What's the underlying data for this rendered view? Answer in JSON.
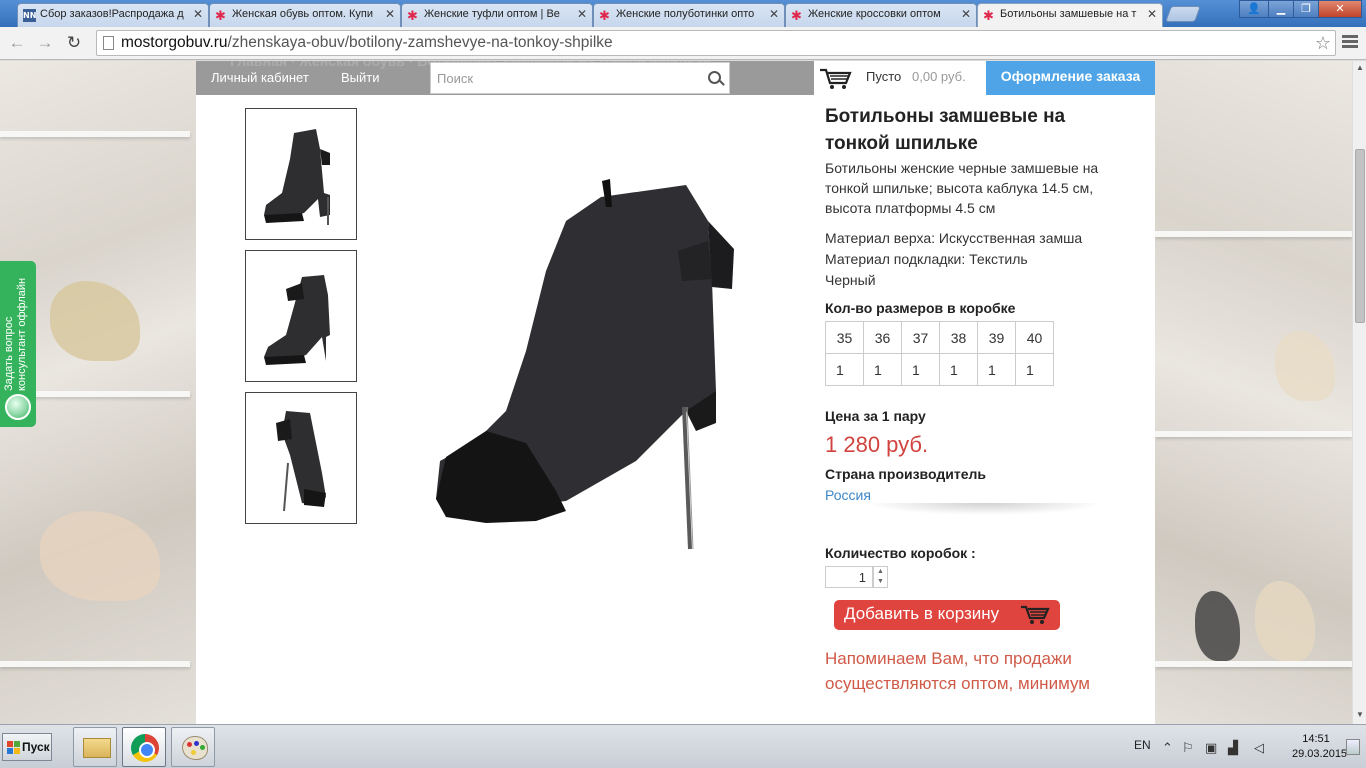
{
  "browser": {
    "tabs": [
      {
        "label": "Сбор заказов!Распродажа д",
        "icon": "nn-favicon",
        "active": false
      },
      {
        "label": "Женская обувь оптом. Купи",
        "icon": "star-favicon",
        "active": false
      },
      {
        "label": "Женские туфли оптом | Ве",
        "icon": "star-favicon",
        "active": false
      },
      {
        "label": "Женские полуботинки опто",
        "icon": "star-favicon",
        "active": false
      },
      {
        "label": "Женские кроссовки оптом",
        "icon": "star-favicon",
        "active": false
      },
      {
        "label": "Ботильоны замшевые на т",
        "icon": "star-favicon",
        "active": true
      }
    ],
    "address": {
      "host": "mostorgobuv.ru",
      "path": "/zhenskaya-obuv/botilony-zamshevye-na-tonkoy-shpilke"
    }
  },
  "header": {
    "breadcrumb_behind": "Главная · Женская обувь · Ботильоны замшевые на тонкой шпильке",
    "account_link": "Личный кабинет",
    "logout_link": "Выйти",
    "search_placeholder": "Поиск",
    "cart_status": "Пусто",
    "cart_sum": "0,00 руб.",
    "checkout_label": "Оформление заказа"
  },
  "product": {
    "title": "Ботильоны замшевые на тонкой шпильке",
    "description": "Ботильоны женские черные замшевые на тонкой шпильке; высота каблука 14.5 см, высота платформы 4.5 см",
    "material_upper": "Материал верха: Искусственная замша",
    "material_lining": "Материал подкладки: Текстиль",
    "color": "Черный",
    "sizes_label": "Кол-во размеров в коробке",
    "sizes": [
      "35",
      "36",
      "37",
      "38",
      "39",
      "40"
    ],
    "size_counts": [
      "1",
      "1",
      "1",
      "1",
      "1",
      "1"
    ],
    "price_label": "Цена за 1 пару",
    "price": "1 280 руб.",
    "country_label": "Страна производитель",
    "country": "Россия",
    "quantity_label": "Количество коробок :",
    "quantity_value": "1",
    "add_to_cart": "Добавить в корзину",
    "reminder": "Напоминаем Вам, что продажи осуществляются оптом, минимум"
  },
  "feedback_widget": {
    "line1": "Задать вопрос",
    "line2": "консультант оффлайн"
  },
  "taskbar": {
    "start_label": "Пуск",
    "lang": "EN",
    "time": "14:51",
    "date": "29.03.2015"
  },
  "colors": {
    "price": "#d0433e",
    "checkout_bg": "#4ea4e6",
    "add_to_cart_bg": "#e0443e",
    "country_link": "#3b87c8",
    "feedback_bg": "#35b35c"
  }
}
